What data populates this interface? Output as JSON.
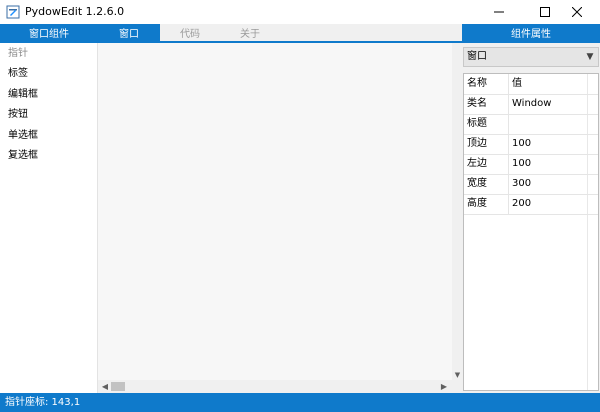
{
  "window": {
    "title": "PydowEdit 1.2.6.0",
    "controls": {
      "minimize": "—",
      "maximize": "☐",
      "close": "✕"
    }
  },
  "tabs": {
    "left_tab": "窗口组件",
    "main_tabs": [
      "窗口",
      "代码",
      "关于"
    ],
    "right_tab": "组件属性"
  },
  "palette": {
    "items": [
      "指针",
      "标签",
      "编辑框",
      "按钮",
      "单选框",
      "复选框"
    ]
  },
  "properties": {
    "selected_object": "窗口",
    "header": {
      "name": "名称",
      "value": "值"
    },
    "rows": [
      {
        "name": "类名",
        "value": "Window"
      },
      {
        "name": "标题",
        "value": ""
      },
      {
        "name": "顶边",
        "value": "100"
      },
      {
        "name": "左边",
        "value": "100"
      },
      {
        "name": "宽度",
        "value": "300"
      },
      {
        "name": "高度",
        "value": "200"
      }
    ]
  },
  "statusbar": {
    "text": "指针座标: 143,1"
  },
  "colors": {
    "accent": "#0f7acb"
  },
  "icons": {
    "app": "app-icon",
    "dropdown": "chevron-down-icon",
    "scroll_left": "arrow-left-icon",
    "scroll_right": "arrow-right-icon",
    "scroll_down": "arrow-down-icon"
  }
}
